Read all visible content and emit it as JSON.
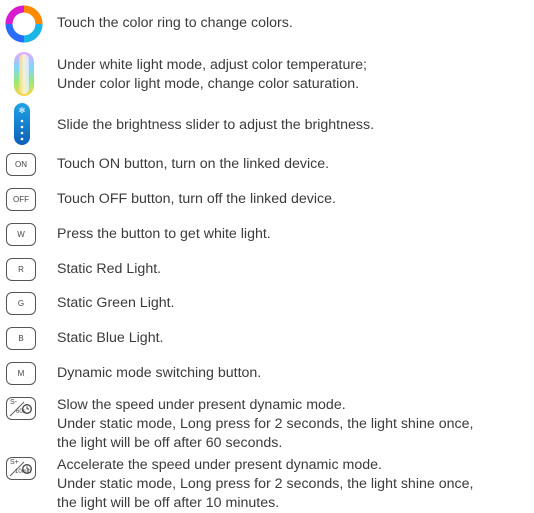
{
  "items": [
    {
      "icon": "color-ring-icon",
      "lines": [
        "Touch the color ring to change colors."
      ]
    },
    {
      "icon": "color-temperature-bar-icon",
      "lines": [
        "Under white light mode, adjust color temperature;",
        "Under color light mode, change color saturation."
      ]
    },
    {
      "icon": "brightness-slider-icon",
      "lines": [
        "Slide the brightness slider to adjust the brightness."
      ]
    },
    {
      "icon": "button",
      "label": "ON",
      "lines": [
        "Touch ON button, turn on the linked device."
      ]
    },
    {
      "icon": "button",
      "label": "OFF",
      "lines": [
        "Touch OFF button, turn off the linked device."
      ]
    },
    {
      "icon": "button",
      "label": "W",
      "lines": [
        "Press the button to get white light."
      ]
    },
    {
      "icon": "button",
      "label": "R",
      "lines": [
        "Static Red Light."
      ]
    },
    {
      "icon": "button",
      "label": "G",
      "lines": [
        "Static Green Light."
      ]
    },
    {
      "icon": "button",
      "label": "B",
      "lines": [
        "Static Blue Light."
      ]
    },
    {
      "icon": "button",
      "label": "M",
      "lines": [
        "Dynamic mode switching button."
      ]
    },
    {
      "icon": "speed-timer-button",
      "label_top": "S-",
      "label_bottom": "60s",
      "lines": [
        "Slow the speed under present dynamic mode.",
        "Under static mode, Long press for 2 seconds, the light shine once,",
        "the light will be off after 60 seconds."
      ]
    },
    {
      "icon": "speed-timer-button",
      "label_top": "S+",
      "label_bottom": "10min",
      "lines": [
        "Accelerate the speed under present dynamic mode.",
        "Under static mode, Long press for 2 seconds, the light shine once,",
        "the light will be off after 10 minutes."
      ]
    }
  ]
}
